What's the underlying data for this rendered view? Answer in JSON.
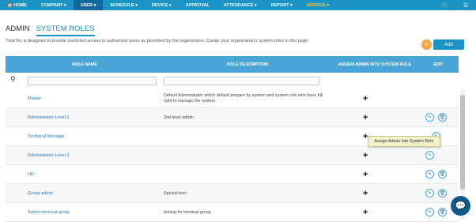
{
  "nav": {
    "items": [
      {
        "label": "🏠 HOME",
        "active": false
      },
      {
        "label": "COMPANY ▾",
        "active": false
      },
      {
        "label": "USER ▾",
        "active": true
      },
      {
        "label": "SCHEDULE ▾",
        "active": false
      },
      {
        "label": "DEVICE ▾",
        "active": false
      },
      {
        "label": "APPROVAL",
        "active": false
      },
      {
        "label": "ATTENDANCE ▾",
        "active": false
      },
      {
        "label": "REPORT ▾",
        "active": false
      },
      {
        "label": "SERVICE ▾",
        "active": false
      }
    ],
    "cart_icon": "cart-icon",
    "menu_icon": "menu-icon"
  },
  "tabs": {
    "admin": "ADMIN",
    "system_roles": "SYSTEM ROLES"
  },
  "intro": "TimeTec is designed to provide restricted access to authorized users as permitted by the organization. Create your organization's system roles in this page.",
  "buttons": {
    "add": "Add",
    "filter_icon": "filter-icon"
  },
  "table": {
    "headers": {
      "name": "ROLE NAME",
      "desc": "ROLE DESCRIPTION",
      "assign": "ASSIGN ADMIN INTO SYSTEM ROLE",
      "edit": "EDIT"
    },
    "rows": [
      {
        "name": "Master",
        "desc": "Default Administrator which default prepare by system and system role who have full right to manage the system.",
        "plus": "+"
      },
      {
        "name": "Administrator Level 2",
        "desc": "2nd level admin",
        "plus": "+"
      },
      {
        "name": "Technical Manager",
        "desc": "",
        "plus": "+"
      },
      {
        "name": "Administrator Level 3",
        "desc": "",
        "plus": "+"
      },
      {
        "name": "HR",
        "desc": "",
        "plus": "+"
      },
      {
        "name": "Group admin",
        "desc": "Special test",
        "plus": "+"
      },
      {
        "name": "Admin terminal group",
        "desc": "testing for terminal group",
        "plus": "+"
      }
    ]
  },
  "tooltip": "Assign Admin into System Role",
  "accent": "#1b93c4"
}
